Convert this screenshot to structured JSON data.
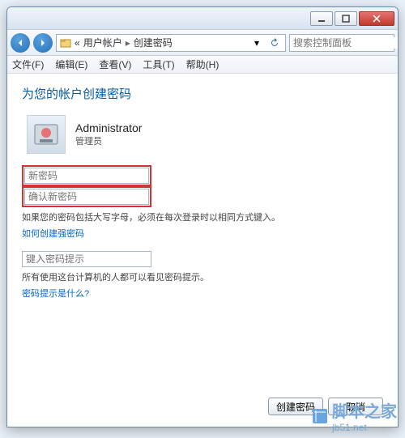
{
  "breadcrumb": {
    "prefix": "«",
    "item1": "用户帐户",
    "item2": "创建密码"
  },
  "search": {
    "placeholder": "搜索控制面板"
  },
  "menu": {
    "file": "文件(F)",
    "edit": "编辑(E)",
    "view": "查看(V)",
    "tools": "工具(T)",
    "help": "帮助(H)"
  },
  "page": {
    "title": "为您的帐户创建密码",
    "user": {
      "name": "Administrator",
      "role": "管理员"
    },
    "fields": {
      "newpw": "新密码",
      "confirmpw": "确认新密码",
      "hint": "键入密码提示"
    },
    "note1": "如果您的密码包括大写字母，必须在每次登录时以相同方式键入。",
    "link1": "如何创建强密码",
    "note2": "所有使用这台计算机的人都可以看见密码提示。",
    "link2": "密码提示是什么?",
    "btn_create": "创建密码",
    "btn_cancel": "取消"
  },
  "watermark": {
    "site": "脚本之家",
    "url": "jb51.net"
  }
}
